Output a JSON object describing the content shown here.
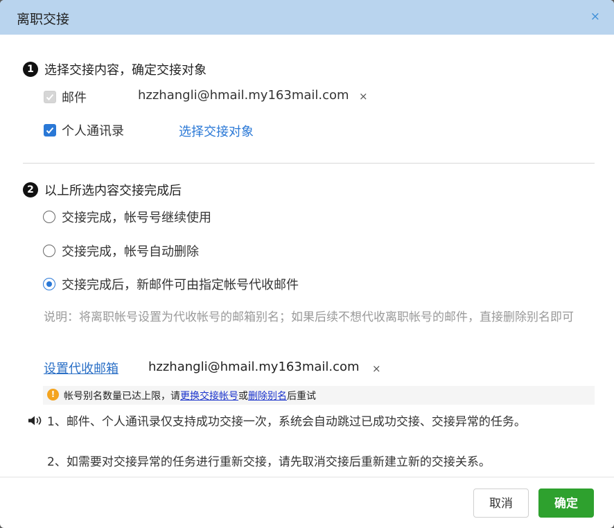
{
  "dialog": {
    "title": "离职交接",
    "close_glyph": "×"
  },
  "section1": {
    "number": "1",
    "title": "选择交接内容，确定交接对象",
    "mail_label": "邮件",
    "mail_account": "hzzhangli@hmail.my163mail.com",
    "remove_glyph": "×",
    "contacts_label": "个人通讯录",
    "select_target_link": "选择交接对象"
  },
  "section2": {
    "number": "2",
    "title": "以上所选内容交接完成后",
    "options": [
      {
        "label": "交接完成，帐号号继续使用",
        "selected": false
      },
      {
        "label": "交接完成，帐号自动删除",
        "selected": false
      },
      {
        "label": "交接完成后，新邮件可由指定帐号代收邮件",
        "selected": true
      }
    ],
    "note": "说明：将离职帐号设置为代收帐号的邮箱别名；如果后续不想代收离职帐号的邮件，直接删除别名即可",
    "set_mailbox_link": "设置代收邮箱",
    "proxy_account": "hzzhangli@hmail.my163mail.com",
    "remove_glyph": "×"
  },
  "warning": {
    "icon": "!",
    "text_before": "帐号别名数量已达上限，请",
    "link1": "更换交接帐号",
    "text_mid": "或",
    "link2": "删除别名",
    "text_after": "后重试"
  },
  "tips": {
    "line1": "1、邮件、个人通讯录仅支持成功交接一次，系统会自动跳过已成功交接、交接异常的任务。",
    "line2": "2、如需要对交接异常的任务进行重新交接，请先取消交接后重新建立新的交接关系。"
  },
  "footer": {
    "cancel_label": "取消",
    "ok_label": "确定"
  },
  "colors": {
    "titlebar": "#b9d4ee",
    "accent_blue": "#2a78d6",
    "ok_green": "#2ea12e",
    "warning_orange": "#f4a41f"
  },
  "icons": [
    "close-icon",
    "checkbox-icon",
    "radio-icon",
    "warning-icon",
    "speaker-icon"
  ]
}
